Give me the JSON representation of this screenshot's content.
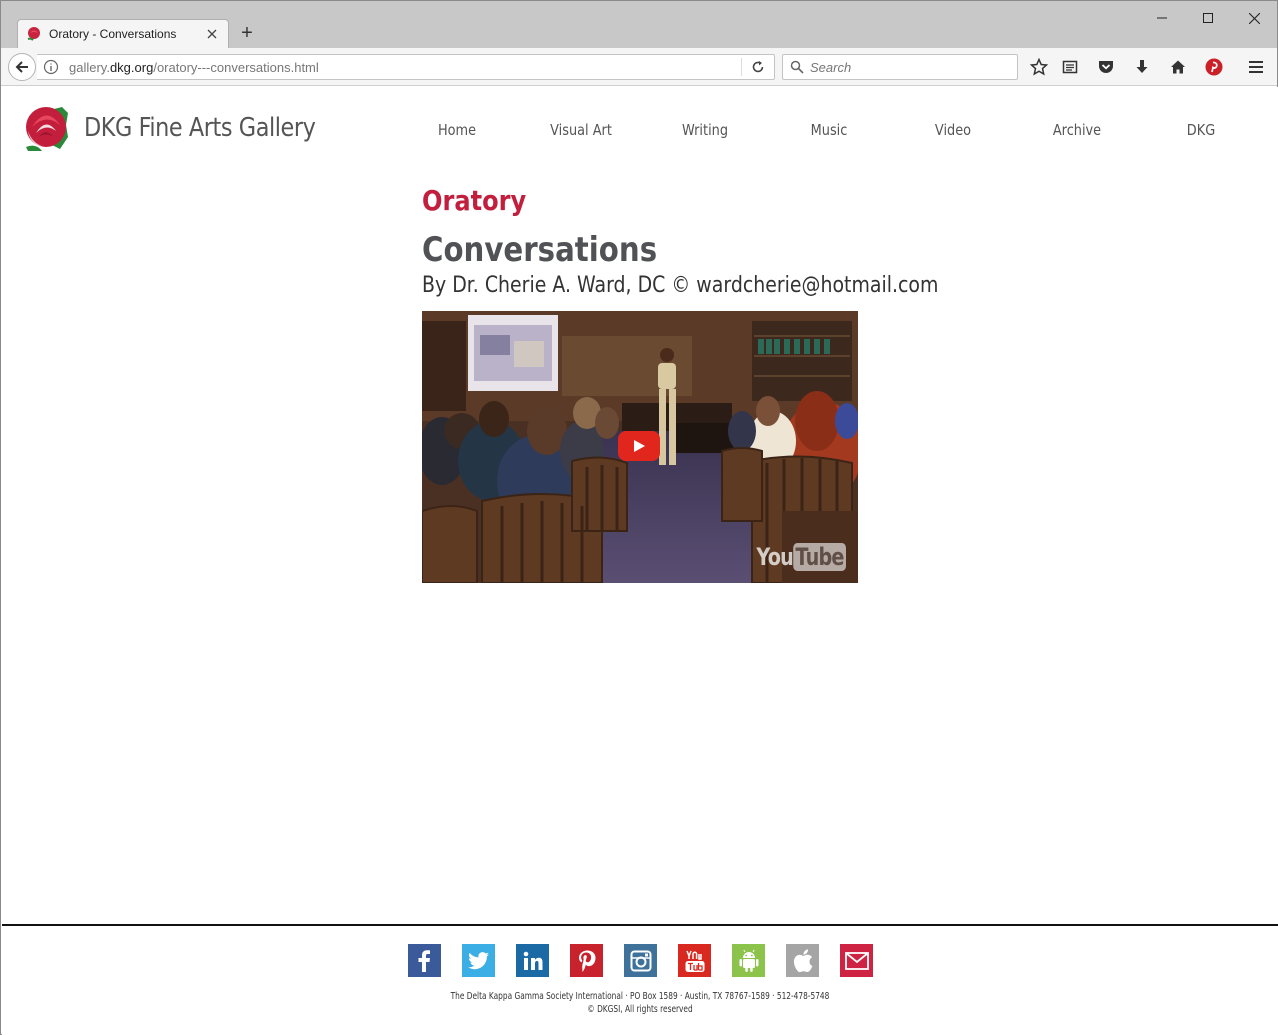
{
  "browser": {
    "tab_title": "Oratory - Conversations",
    "new_tab_label": "+",
    "url_prefix": "gallery.",
    "url_domain": "dkg.org",
    "url_path": "/oratory---conversations.html",
    "search_placeholder": "Search"
  },
  "site": {
    "title": "DKG Fine Arts Gallery",
    "nav": [
      "Home",
      "Visual Art",
      "Writing",
      "Music",
      "Video",
      "Archive",
      "DKG"
    ]
  },
  "content": {
    "section": "Oratory",
    "title": "Conversations",
    "byline": "By Dr. Cherie A. Ward, DC © wardcherie@hotmail.com"
  },
  "video": {
    "watermark_you": "You",
    "watermark_tube": "Tube"
  },
  "footer": {
    "social": [
      {
        "name": "facebook",
        "color": "#3b5a9a"
      },
      {
        "name": "twitter",
        "color": "#3aaee5"
      },
      {
        "name": "linkedin",
        "color": "#1b6aa5"
      },
      {
        "name": "pinterest",
        "color": "#c8232c"
      },
      {
        "name": "instagram",
        "color": "#3f729b"
      },
      {
        "name": "youtube",
        "color": "#d9281f"
      },
      {
        "name": "android",
        "color": "#8cc34b"
      },
      {
        "name": "apple",
        "color": "#a5a5a5"
      },
      {
        "name": "email",
        "color": "#cf2344"
      }
    ],
    "address": "The Delta Kappa Gamma Society International · PO Box 1589 · Austin, TX 78767-1589 · 512-478-5748",
    "copyright": "© DKGSI, All rights reserved"
  }
}
